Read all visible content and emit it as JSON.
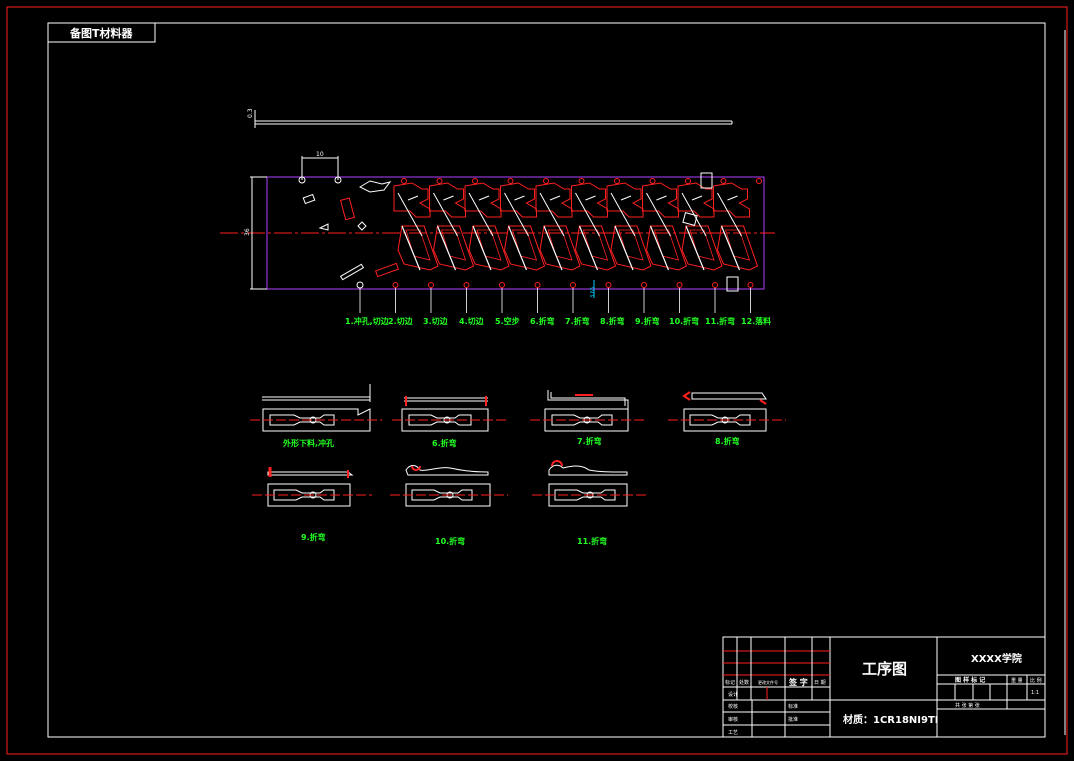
{
  "title_tab": "备图T材料器",
  "strip_dims": {
    "thickness": "0.3",
    "pitch": "10",
    "width": "36",
    "feed": "3.65"
  },
  "station_labels": [
    "1.冲孔,切边",
    "2.切边",
    "3.切边",
    "4.切边",
    "5.空步",
    "6.折弯",
    "7.折弯",
    "8.折弯",
    "9.折弯",
    "10.折弯",
    "11.折弯",
    "12.落料"
  ],
  "views": [
    {
      "label": "外形下料,冲孔"
    },
    {
      "label": "6.折弯"
    },
    {
      "label": "7.折弯"
    },
    {
      "label": "8.折弯"
    },
    {
      "label": "9.折弯"
    },
    {
      "label": "10.折弯"
    },
    {
      "label": "11.折弯"
    }
  ],
  "title_block": {
    "drawing_title": "工序图",
    "school": "XXXX学院",
    "material": "材质：1CR18NI9TI",
    "sign_header": "签 字",
    "date_header": "日 期",
    "stage_header": "图 样 标 记",
    "weight_header": "重 量",
    "scale_header": "比 例",
    "scale_value": "1:1",
    "sheet_info": "共 张  第 张",
    "r_designer": "设计",
    "r_checker": "校核",
    "r_reviewer": "审核",
    "r_process": "工艺",
    "r_standard": "标准",
    "r_approve": "批准",
    "r_mark": "标记",
    "r_count": "处数",
    "r_docno": "更改文件号"
  },
  "colors": {
    "background": "#000000",
    "frame": "#ff2020",
    "line": "#ffffff",
    "part_outline": "#ff2020",
    "strip_border": "#b040ff",
    "label": "#22ff22",
    "dim": "#00d0ff"
  }
}
